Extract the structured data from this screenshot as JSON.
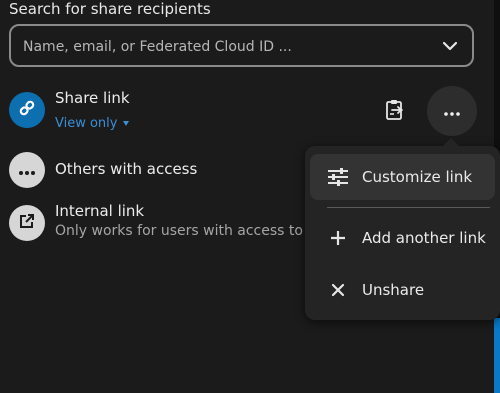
{
  "search": {
    "label": "Search for share recipients",
    "placeholder": "Name, email, or Federated Cloud ID ..."
  },
  "share_link": {
    "title": "Share link",
    "permission": "View only"
  },
  "others": {
    "title": "Others with access"
  },
  "internal_link": {
    "title": "Internal link",
    "subtitle": "Only works for users with access to this folder"
  },
  "menu": {
    "items": [
      {
        "label": "Customize link",
        "icon": "tune-icon"
      },
      {
        "label": "Add another link",
        "icon": "plus-icon"
      },
      {
        "label": "Unshare",
        "icon": "close-icon"
      }
    ]
  },
  "colors": {
    "accent": "#0e6fb0",
    "link_text": "#3a8fd6",
    "background": "#1b1b1b"
  }
}
